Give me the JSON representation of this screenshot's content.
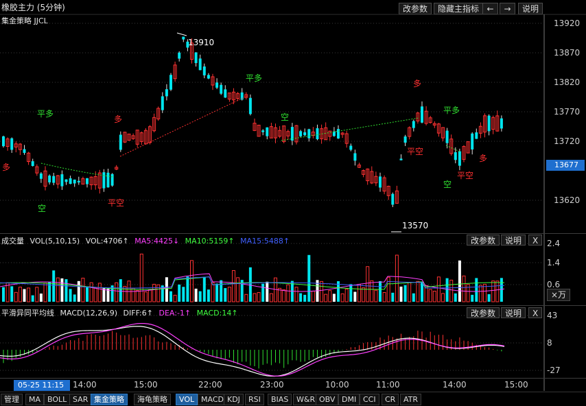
{
  "header": {
    "title": "橡胶主力 (5分钟)",
    "strategy": "集金策略 JJCL",
    "buttons": [
      "改参数",
      "隐藏主指标",
      "←",
      "→",
      "说明"
    ]
  },
  "main_chart": {
    "y_ticks": [
      "13920",
      "13870",
      "13820",
      "13770",
      "13720",
      "13677",
      "13620"
    ],
    "current_price": "13677",
    "high_label": "13910",
    "low_label": "13570",
    "signals": [
      {
        "text": "多",
        "color": "#ff3030"
      },
      {
        "text": "平多",
        "color": "#30e030"
      },
      {
        "text": "空",
        "color": "#30e030"
      },
      {
        "text": "多",
        "color": "#ff3030"
      },
      {
        "text": "平空",
        "color": "#ff3030"
      },
      {
        "text": "平多",
        "color": "#30e030"
      },
      {
        "text": "空",
        "color": "#30e030"
      },
      {
        "text": "多",
        "color": "#ff3030"
      },
      {
        "text": "平空",
        "color": "#ff3030"
      },
      {
        "text": "平多",
        "color": "#30e030"
      },
      {
        "text": "空",
        "color": "#30e030"
      },
      {
        "text": "平空",
        "color": "#ff3030"
      },
      {
        "text": "多",
        "color": "#ff3030"
      }
    ]
  },
  "volume_panel": {
    "name": "成交量",
    "params": "VOL(5,10,15)",
    "vol": "VOL:4706↑",
    "ma5": "MA5:4425↓",
    "ma10": "MA10:5159↑",
    "ma15": "MA15:5488↑",
    "y_ticks": [
      "2.4",
      "1.4",
      "0.6"
    ],
    "unit": "×万",
    "buttons": [
      "改参数",
      "说明",
      "X"
    ]
  },
  "macd_panel": {
    "name": "平滑异同平均线",
    "params": "MACD(12,26,9)",
    "diff": "DIFF:6↑",
    "dea": "DEA:-1↑",
    "macd": "MACD:14↑",
    "y_ticks": [
      "43",
      "8",
      "-27"
    ],
    "buttons": [
      "改参数",
      "说明",
      "X"
    ]
  },
  "time_axis": {
    "cursor_time": "05-25 11:15",
    "labels": [
      "14:00",
      "15:00",
      "22:00",
      "23:00",
      "10:00",
      "11:00",
      "14:00",
      "15:00"
    ]
  },
  "tabs": [
    "管理",
    "MA",
    "BOLL",
    "SAR",
    "集金策略",
    "海龟策略",
    "VOL",
    "MACD",
    "KDJ",
    "RSI",
    "BIAS",
    "W&R",
    "OBV",
    "DMI",
    "CCI",
    "CR",
    "ATR"
  ],
  "active_tabs": [
    "集金策略",
    "VOL"
  ],
  "colors": {
    "up": "#ff3232",
    "down": "#00e5ee",
    "bg": "#000000",
    "ma5": "#ff40ff",
    "ma10": "#40ff40",
    "ma15": "#4060ff",
    "accent": "#1f5f9f"
  }
}
